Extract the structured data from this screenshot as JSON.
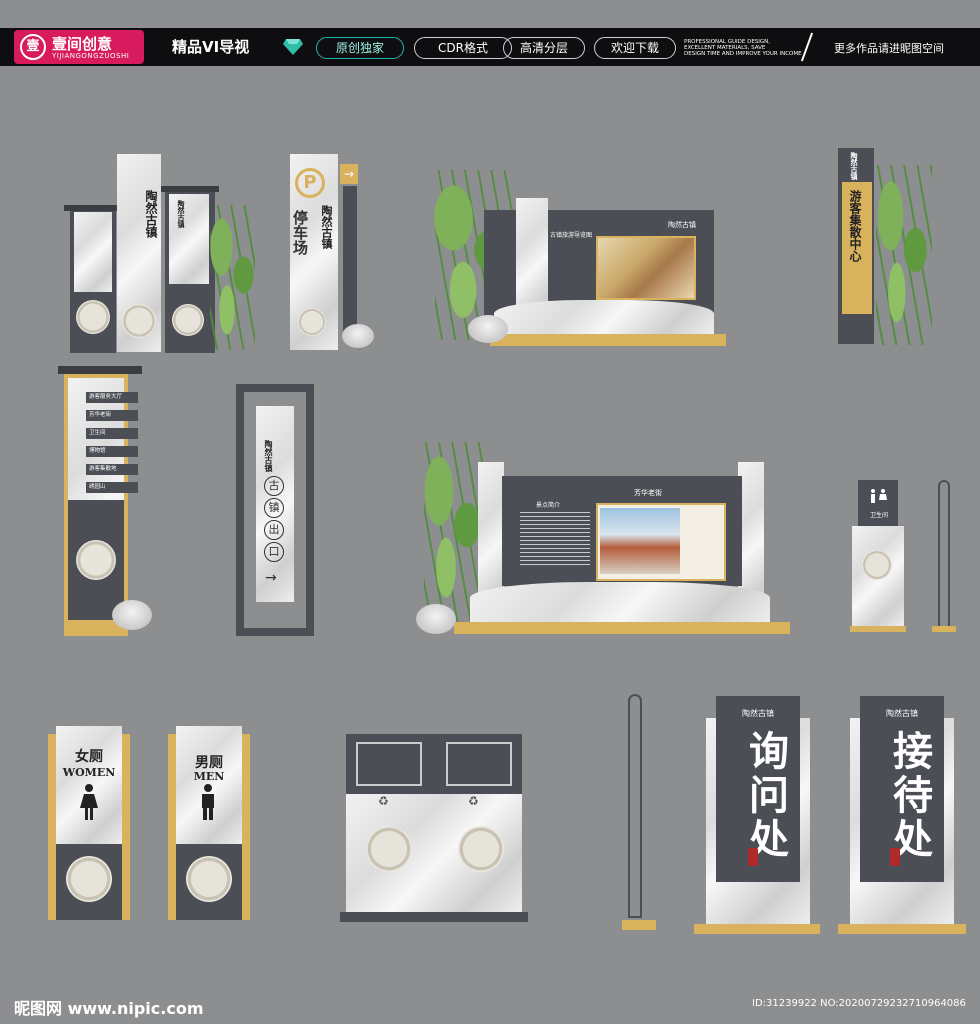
{
  "header": {
    "brand_icon": "壹",
    "brand_name": "壹间创意",
    "brand_pinyin": "YIJIANGONGZUOSHI",
    "vi_title": "精品VI导视",
    "pills": [
      "原创独家",
      "CDR格式",
      "高清分层",
      "欢迎下载"
    ],
    "english_lines": [
      "PROFESSIONAL GUIDE DESIGN,",
      "EXCELLENT MATERIALS, SAVE",
      "DESIGN TIME AND IMPROVE YOUR INCOME"
    ],
    "more_works": "更多作品请进昵图空间"
  },
  "signs": {
    "vertical_a_title": "陶然古镇",
    "vertical_a_sub": "陶然古镇",
    "parking_label": "停车场",
    "parking_symbol": "P",
    "parking_brand": "陶然古镇",
    "map_board_title": "古镇旅游导览图",
    "map_board_brand": "陶然古镇",
    "tourist_center": "游客集散中心",
    "tourist_brand": "陶然古镇",
    "direction_rows": [
      "游客服务大厅",
      "芳华老街",
      "卫生间",
      "博物馆",
      "游客集散地",
      "绣园山"
    ],
    "exit_brand": "陶然古镇",
    "exit_chars": [
      "古",
      "镇",
      "出",
      "口"
    ],
    "intro_board_title": "芳华老街",
    "intro_board_heading": "景点简介",
    "toilet_small": "卫生间",
    "women_cn": "女厕",
    "women_en": "WOMEN",
    "men_cn": "男厕",
    "men_en": "MEN",
    "inquiry_brand": "陶然古镇",
    "inquiry": "询问处",
    "reception_brand": "陶然古镇",
    "reception": "接待处",
    "arrow": "→"
  },
  "footer": {
    "site": "昵图网 www.nipic.com",
    "id_line": "ID:31239922 NO:20200729232710964086"
  },
  "colors": {
    "background": "#8d8e90",
    "dark_panel": "#4b4f55",
    "gold": "#d9b25e",
    "brand": "#d71b5c",
    "pill_accent": "#1fb3a5"
  }
}
